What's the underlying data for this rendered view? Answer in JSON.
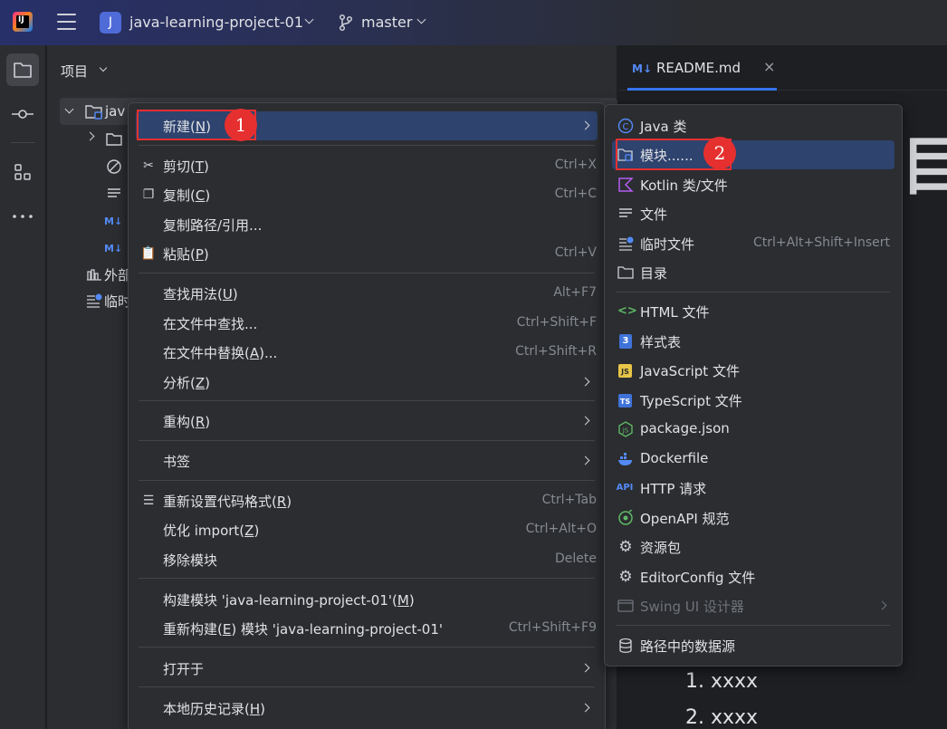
{
  "titlebar": {
    "project_initial": "J",
    "project_name": "java-learning-project-01",
    "branch": "master",
    "logo_text": "IJ"
  },
  "project_panel": {
    "title": "项目",
    "root_item": "jav",
    "external_libs": "外部",
    "scratches": "临时"
  },
  "editor": {
    "tab_prefix": "M↓",
    "tab_label": "README.md",
    "big_text": "目",
    "list_items": [
      "1. xxxx",
      "2. xxxx"
    ]
  },
  "main_menu": {
    "items": [
      {
        "label": "新建(N)",
        "mnemonic_index": 3,
        "shortcut": "",
        "submenu": true
      },
      {
        "label": "剪切(T)",
        "shortcut": "Ctrl+X",
        "icon": "scissors-icon"
      },
      {
        "label": "复制(C)",
        "shortcut": "Ctrl+C",
        "icon": "copy-icon"
      },
      {
        "label": "复制路径/引用...",
        "shortcut": ""
      },
      {
        "label": "粘贴(P)",
        "shortcut": "Ctrl+V",
        "icon": "clipboard-icon"
      },
      {
        "label": "查找用法(U)",
        "shortcut": "Alt+F7"
      },
      {
        "label": "在文件中查找...",
        "shortcut": "Ctrl+Shift+F"
      },
      {
        "label": "在文件中替换(A)...",
        "shortcut": "Ctrl+Shift+R"
      },
      {
        "label": "分析(Z)",
        "shortcut": "",
        "submenu": true
      },
      {
        "label": "重构(R)",
        "shortcut": "",
        "submenu": true
      },
      {
        "label": "书签",
        "shortcut": "",
        "submenu": true
      },
      {
        "label": "重新设置代码格式(R)",
        "shortcut": "Ctrl+Tab",
        "icon": "format-icon"
      },
      {
        "label": "优化 import(Z)",
        "shortcut": "Ctrl+Alt+O"
      },
      {
        "label": "移除模块",
        "shortcut": "Delete"
      },
      {
        "label": "构建模块 'java-learning-project-01'(M)",
        "shortcut": ""
      },
      {
        "label": "重新构建(E) 模块 'java-learning-project-01'",
        "shortcut": "Ctrl+Shift+F9"
      },
      {
        "label": "打开于",
        "shortcut": "",
        "submenu": true
      },
      {
        "label": "本地历史记录(H)",
        "shortcut": "",
        "submenu": true
      }
    ]
  },
  "sub_menu": {
    "items": [
      {
        "label": "Java 类",
        "shortcut": "",
        "icon": "java-class-icon"
      },
      {
        "label": "模块......",
        "shortcut": "",
        "icon": "module-folder-icon"
      },
      {
        "label": "Kotlin 类/文件",
        "shortcut": "",
        "icon": "kotlin-icon"
      },
      {
        "label": "文件",
        "shortcut": "",
        "icon": "file-icon"
      },
      {
        "label": "临时文件",
        "shortcut": "Ctrl+Alt+Shift+Insert",
        "icon": "scratch-file-icon"
      },
      {
        "label": "目录",
        "shortcut": "",
        "icon": "folder-icon"
      },
      {
        "label": "HTML 文件",
        "shortcut": "",
        "icon": "html-icon"
      },
      {
        "label": "样式表",
        "shortcut": "",
        "icon": "css-icon"
      },
      {
        "label": "JavaScript 文件",
        "shortcut": "",
        "icon": "javascript-icon"
      },
      {
        "label": "TypeScript 文件",
        "shortcut": "",
        "icon": "typescript-icon"
      },
      {
        "label": "package.json",
        "shortcut": "",
        "icon": "nodejs-icon"
      },
      {
        "label": "Dockerfile",
        "shortcut": "",
        "icon": "docker-icon"
      },
      {
        "label": "HTTP 请求",
        "shortcut": "",
        "icon": "api-icon"
      },
      {
        "label": "OpenAPI 规范",
        "shortcut": "",
        "icon": "openapi-icon"
      },
      {
        "label": "资源包",
        "shortcut": "",
        "icon": "gear-icon"
      },
      {
        "label": "EditorConfig 文件",
        "shortcut": "",
        "icon": "gear-icon"
      },
      {
        "label": "Swing UI 设计器",
        "shortcut": "",
        "icon": "swing-icon",
        "disabled": true,
        "submenu": true
      },
      {
        "label": "路径中的数据源",
        "shortcut": "",
        "icon": "database-icon"
      }
    ]
  },
  "callouts": {
    "first": "1",
    "second": "2"
  },
  "colors": {
    "highlight": "#2e436e",
    "callout": "#e5302f",
    "accent": "#3574f0"
  }
}
